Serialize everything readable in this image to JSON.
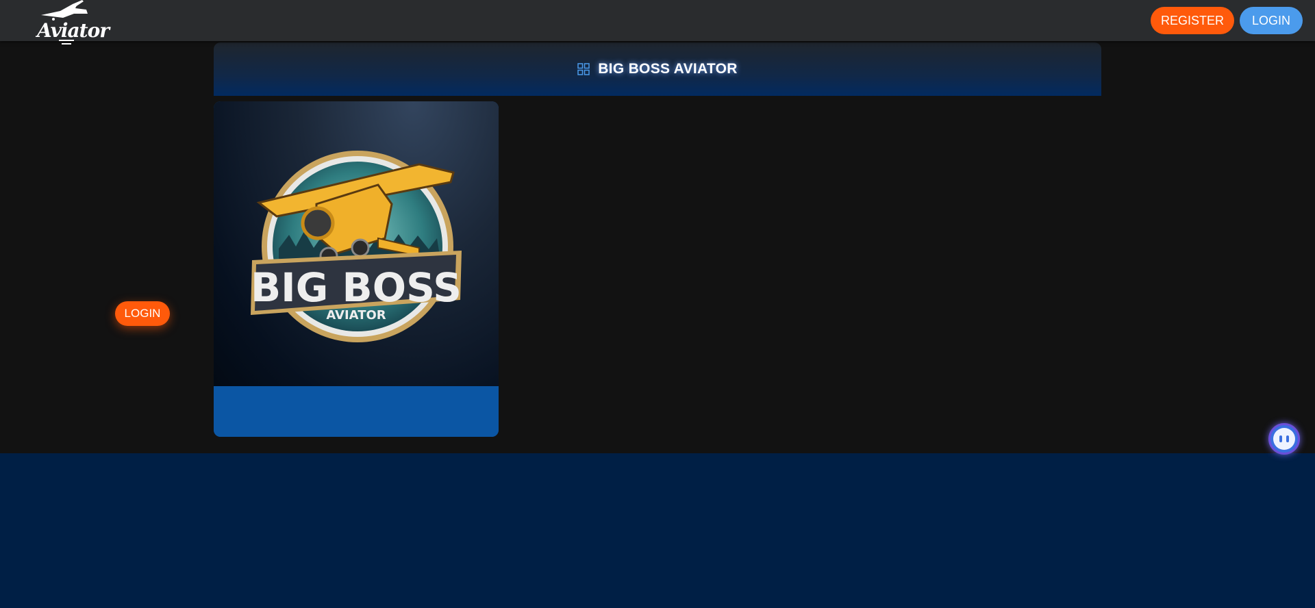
{
  "header": {
    "logo_text": "Aviator",
    "register_label": "REGISTER",
    "login_label": "LOGIN"
  },
  "section": {
    "title": "BIG BOSS AVIATOR",
    "icon": "grid-icon"
  },
  "game_card": {
    "title_line1": "BIG BOSS",
    "title_line2": "AVIATOR",
    "login_label": "LOGIN"
  },
  "chat": {
    "icon": "chat-bot-icon"
  },
  "colors": {
    "register_bg": "#ff5a0b",
    "login_bg": "#4b9bec",
    "card_footer_bg": "#0b56a4",
    "header_bg": "#2a2c2e",
    "page_bg": "#001f45"
  }
}
